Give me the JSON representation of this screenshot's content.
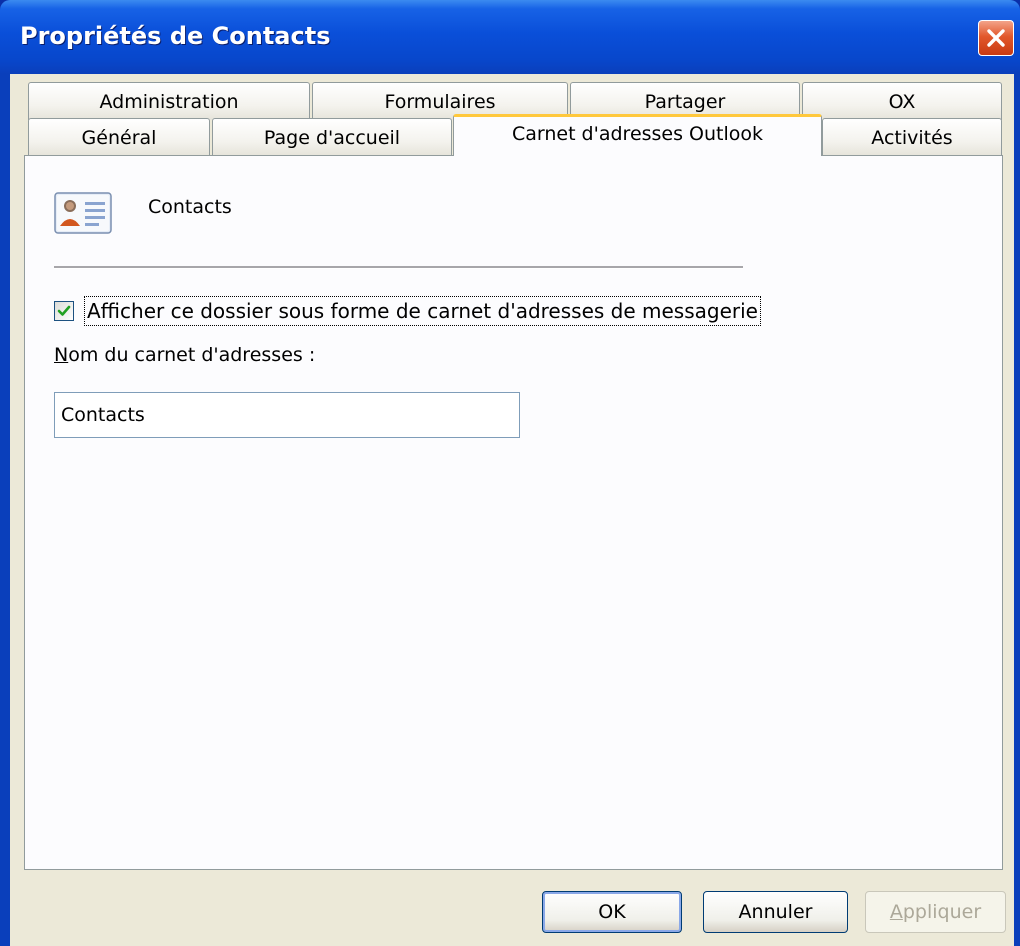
{
  "window": {
    "title": "Propriétés de Contacts"
  },
  "tabs": {
    "row1": [
      "Administration",
      "Formulaires",
      "Partager",
      "OX"
    ],
    "row2": [
      "Général",
      "Page d'accueil",
      "Carnet d'adresses Outlook",
      "Activités"
    ],
    "active": "Carnet d'adresses Outlook"
  },
  "panel": {
    "folder_icon": "contact-card-icon",
    "folder_name": "Contacts",
    "checkbox": {
      "label": "Afficher ce dossier sous forme de carnet d'adresses de messagerie",
      "checked": true
    },
    "field_label_mnemonic": "N",
    "field_label_rest": "om du carnet d'adresses :",
    "field_value": "Contacts"
  },
  "buttons": {
    "ok": "OK",
    "cancel": "Annuler",
    "apply_mnemonic": "A",
    "apply_rest": "ppliquer"
  },
  "colors": {
    "titlebar": "#0a4fd9",
    "active_tab_accent": "#ffc83c",
    "dialog_face": "#ece9d8",
    "check_green": "#21a121"
  }
}
